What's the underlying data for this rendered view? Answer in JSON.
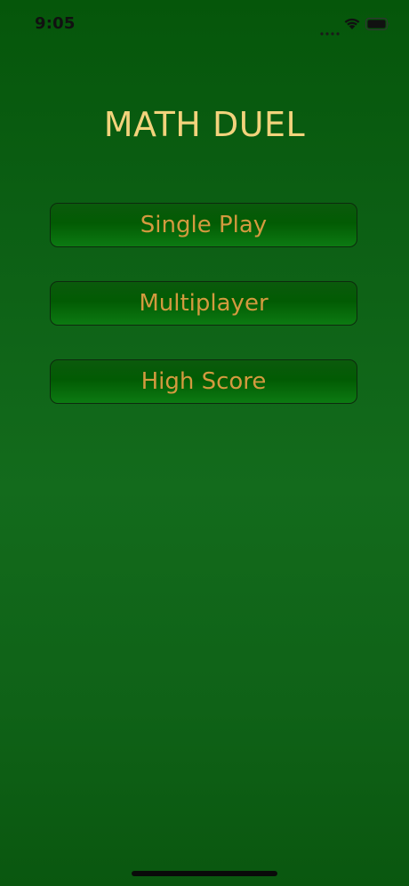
{
  "status_bar": {
    "time": "9:05",
    "signal_icon": "cellular-signal-dots-icon",
    "wifi_icon": "wifi-icon",
    "battery_icon": "battery-full-icon"
  },
  "app": {
    "title": "MATH DUEL",
    "buttons": [
      {
        "label": "Single Play"
      },
      {
        "label": "Multiplayer"
      },
      {
        "label": "High Score"
      }
    ]
  },
  "colors": {
    "background": "#0e6216",
    "title_text": "#f2d37c",
    "button_text": "#d39a3f",
    "button_border": "#0d2a0d"
  }
}
